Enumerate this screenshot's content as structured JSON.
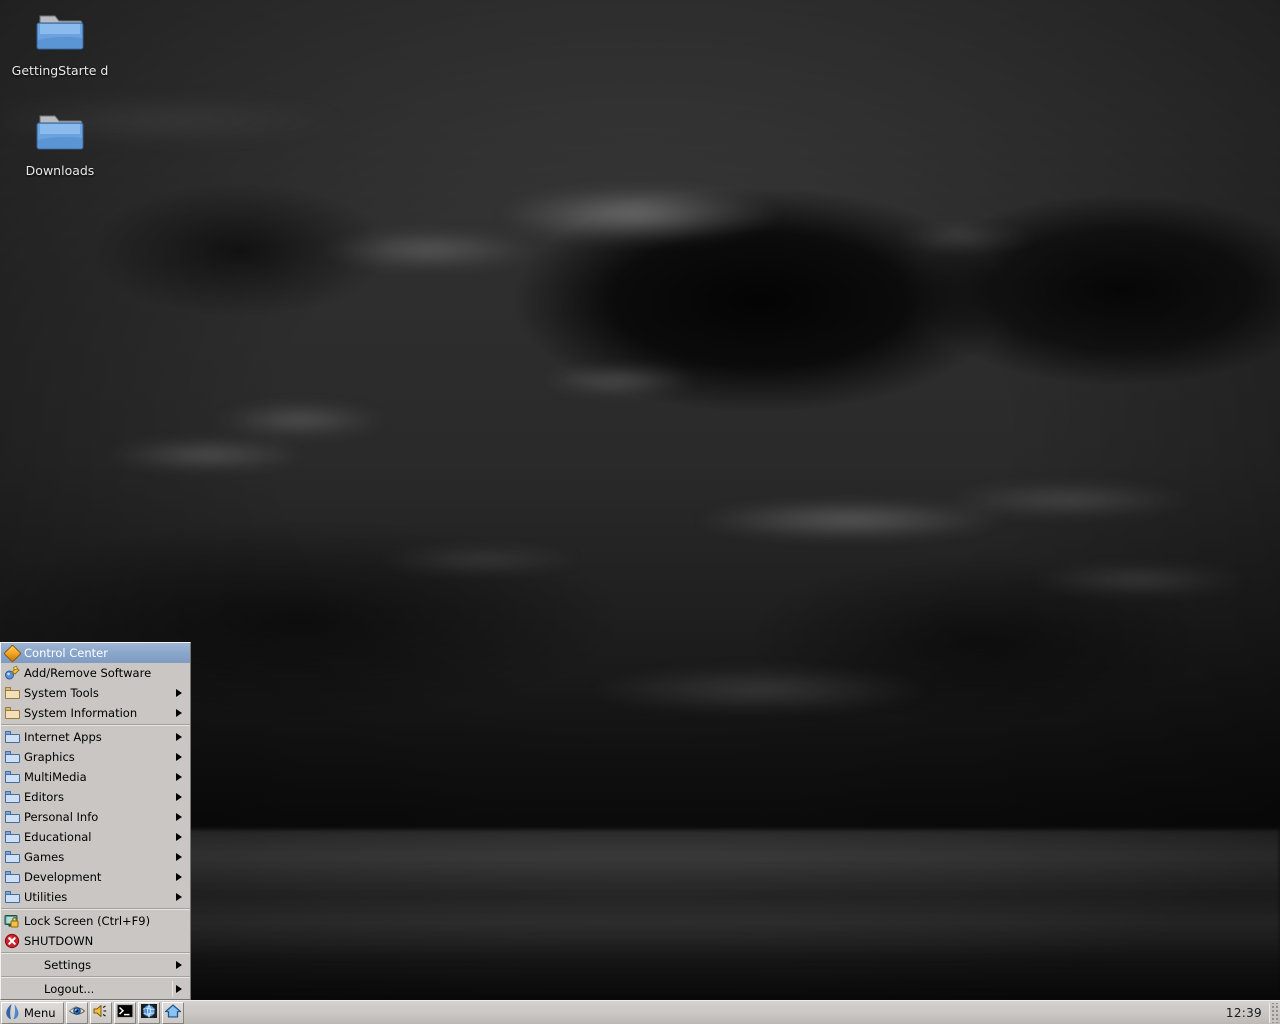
{
  "desktop": {
    "icons": [
      {
        "name": "GettingStarted",
        "label": "GettingStarte\nd",
        "icon": "folder-icon"
      },
      {
        "name": "Downloads",
        "label": "Downloads",
        "icon": "folder-icon"
      }
    ],
    "wallpaper_colors": {
      "sky_top": "#3a3a3a",
      "sky_mid": "#2a2a2a",
      "horizon": "#0d0d0d",
      "water": "#1a1a1a"
    }
  },
  "menu": {
    "items": [
      {
        "label": "Control Center",
        "mnemonic": "C",
        "icon": "diamond-icon",
        "selected": true,
        "arrow": false,
        "indent": false
      },
      {
        "label": "Add/Remove Software",
        "mnemonic": "A",
        "icon": "package-icon",
        "selected": false,
        "arrow": false,
        "indent": false
      },
      {
        "label": "System Tools",
        "mnemonic": "y",
        "icon": "folder-tan-icon",
        "selected": false,
        "arrow": true,
        "indent": false
      },
      {
        "label": "System Information",
        "mnemonic": "y",
        "icon": "folder-tan-icon",
        "selected": false,
        "arrow": true,
        "indent": false
      },
      {
        "separator": true
      },
      {
        "label": "Internet Apps",
        "mnemonic": "I",
        "icon": "folder-blue-icon",
        "selected": false,
        "arrow": true,
        "indent": false
      },
      {
        "label": "Graphics",
        "mnemonic": "G",
        "icon": "folder-blue-icon",
        "selected": false,
        "arrow": true,
        "indent": false
      },
      {
        "label": "MultiMedia",
        "mnemonic": "M",
        "icon": "folder-blue-icon",
        "selected": false,
        "arrow": true,
        "indent": false
      },
      {
        "label": "Editors",
        "mnemonic": "E",
        "icon": "folder-blue-icon",
        "selected": false,
        "arrow": true,
        "indent": false
      },
      {
        "label": "Personal Info",
        "mnemonic": "P",
        "icon": "folder-blue-icon",
        "selected": false,
        "arrow": true,
        "indent": false
      },
      {
        "label": "Educational",
        "mnemonic": "E",
        "icon": "folder-blue-icon",
        "selected": false,
        "arrow": true,
        "indent": false
      },
      {
        "label": "Games",
        "mnemonic": "G",
        "icon": "folder-blue-icon",
        "selected": false,
        "arrow": true,
        "indent": false
      },
      {
        "label": "Development",
        "mnemonic": "D",
        "icon": "folder-blue-icon",
        "selected": false,
        "arrow": true,
        "indent": false
      },
      {
        "label": "Utilities",
        "mnemonic": "U",
        "icon": "folder-blue-icon",
        "selected": false,
        "arrow": true,
        "indent": false
      },
      {
        "separator": true
      },
      {
        "label": "Lock Screen (Ctrl+F9)",
        "mnemonic": "L",
        "icon": "screen-lock-icon",
        "selected": false,
        "arrow": false,
        "indent": false
      },
      {
        "label": "SHUTDOWN",
        "mnemonic": "S",
        "icon": "shutdown-icon",
        "selected": false,
        "arrow": false,
        "indent": false
      },
      {
        "separator": true
      },
      {
        "label": "Settings",
        "mnemonic": "tt",
        "icon": "none",
        "selected": false,
        "arrow": true,
        "indent": true
      },
      {
        "separator": true
      },
      {
        "label": "Logout...",
        "mnemonic": "L",
        "icon": "none",
        "selected": false,
        "arrow": true,
        "indent": true,
        "divider_before_arrow": true
      }
    ]
  },
  "taskbar": {
    "menu_button": {
      "label": "Menu",
      "icon": "mandriva-star-icon"
    },
    "launchers": [
      {
        "name": "show-desktop",
        "icon": "eye-icon"
      },
      {
        "name": "volume",
        "icon": "speaker-icon"
      },
      {
        "name": "terminal",
        "icon": "terminal-icon"
      },
      {
        "name": "web-browser",
        "icon": "globe-icon"
      },
      {
        "name": "home-folder",
        "icon": "home-icon"
      }
    ],
    "clock": "12:39",
    "colors": {
      "bg": "#c9c6c3",
      "highlight": "#efedec",
      "shadow": "#86827d"
    }
  }
}
